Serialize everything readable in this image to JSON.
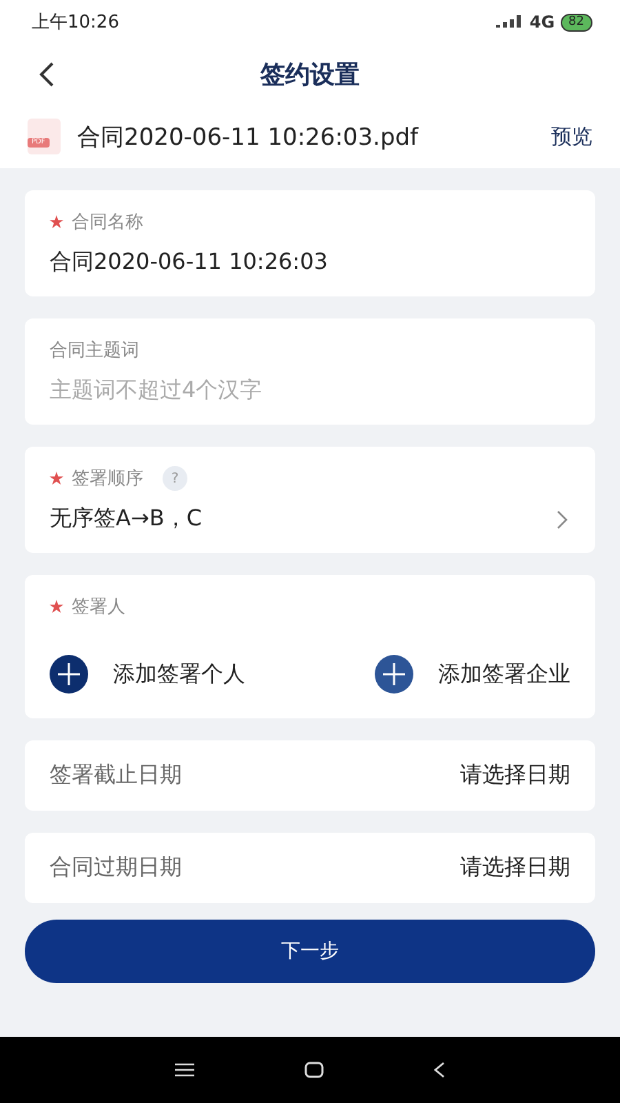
{
  "status_bar": {
    "time": "上午10:26",
    "network": "4G",
    "battery": "82"
  },
  "header": {
    "title": "签约设置"
  },
  "file": {
    "icon_label": "PDF",
    "name": "合同2020-06-11 10:26:03.pdf",
    "action": "预览"
  },
  "cards": [
    {
      "kind": "field",
      "label": "合同名称",
      "required": true,
      "value": "合同2020-06-11 10:26:03"
    },
    {
      "kind": "field",
      "label": "合同主题词",
      "required": false,
      "placeholder": "主题词不超过4个汉字"
    },
    {
      "kind": "select",
      "label": "签署顺序",
      "required": true,
      "help": "?",
      "value": "无序签A→B，C"
    },
    {
      "kind": "signers",
      "label": "签署人",
      "required": true,
      "actions": [
        {
          "label": "添加签署个人",
          "color": "#0d2e6e"
        },
        {
          "label": "添加签署企业",
          "color": "#2d5597"
        }
      ]
    },
    {
      "kind": "date",
      "label": "签署截止日期",
      "value": "请选择日期"
    },
    {
      "kind": "date",
      "label": "合同过期日期",
      "value": "请选择日期"
    }
  ],
  "next_button": "下一步"
}
